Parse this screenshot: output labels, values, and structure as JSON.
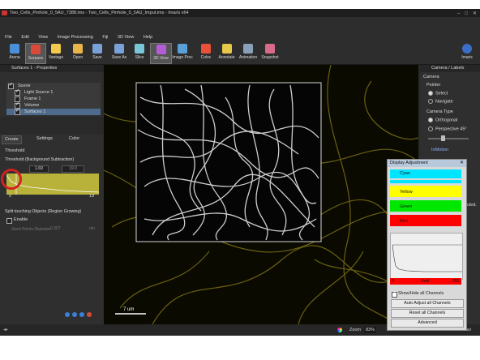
{
  "title": "Two_Cells_Pinhole_0_5AU_7388.ims - Two_Cells_Pinhole_0_5AU_Imput.ims - Imaris x64",
  "menu": [
    "File",
    "Edit",
    "View",
    "Image Processing",
    "Fiji",
    "3D View",
    "Help"
  ],
  "toolbar": {
    "items": [
      {
        "label": "Arena",
        "color": "#4a8fd8"
      },
      {
        "label": "Surpass",
        "color": "#d94a3a"
      },
      {
        "label": "Vantage",
        "color": "#f2c94c"
      },
      {
        "label": "Open",
        "color": "#e9b54a"
      },
      {
        "label": "Save",
        "color": "#7aa0d8"
      },
      {
        "label": "Save As",
        "color": "#7aa0d8"
      },
      {
        "label": "Slice",
        "color": "#78c8d8"
      },
      {
        "label": "3D View",
        "color": "#b45cd8"
      },
      {
        "label": "Image Proc",
        "color": "#5aa0d8"
      },
      {
        "label": "Coloc",
        "color": "#e8503a"
      },
      {
        "label": "Annotate",
        "color": "#e8c84a"
      },
      {
        "label": "Animation",
        "color": "#8aa0b8"
      },
      {
        "label": "Snapshot",
        "color": "#d86a8a"
      }
    ],
    "imaris_label": "Imaris"
  },
  "left": {
    "properties_title": "Surfaces 1 - Properties",
    "tree": [
      "Scene",
      "Light Source 1",
      "Frame 1",
      "Volume",
      "Surfaces 1"
    ],
    "tabs": [
      "Create",
      "Settings",
      "Color"
    ],
    "threshold_label": "Threshold",
    "threshold_sub": "Threshold (Background Subtraction)",
    "threshold_value": "1.69",
    "threshold_value2": "19.0",
    "hist_min": "0",
    "hist_max": "19",
    "split_label": "Split touching Objects (Region Growing)",
    "enable_label": "Enable",
    "seed_label": "Seed Points Diameter",
    "seed_value": "0.367",
    "seed_unit": "um"
  },
  "right": {
    "title": "Camera / Labels",
    "camera": "Camera",
    "pointer": "Pointer",
    "select": "Select",
    "navigate": "Navigate",
    "camera_type": "Camera Type",
    "orthogonal": "Orthogonal",
    "perspective": "Perspective 45°",
    "inmotion": "InMotion",
    "partial1": "cted.",
    "partial2": "ravi"
  },
  "viewport": {
    "scalebar": "7 um",
    "zoom_label": "Zoom",
    "zoom_value": "83%"
  },
  "display_adjustment": {
    "title": "Display Adjustment",
    "channels": [
      {
        "name": "Cyan",
        "color": "#00e5ff"
      },
      {
        "name": "Yellow",
        "color": "#ffff00"
      },
      {
        "name": "Green",
        "color": "#00e800"
      },
      {
        "name": "Red",
        "color": "#ff0000"
      }
    ],
    "range_min": "0",
    "range_channel": "Red",
    "range_max": "255",
    "show_hide_label": "Show/Hide all Channels",
    "auto_adjust": "Auto Adjust all Channels",
    "reset_all": "Reset all Channels",
    "advanced": "Advanced"
  }
}
